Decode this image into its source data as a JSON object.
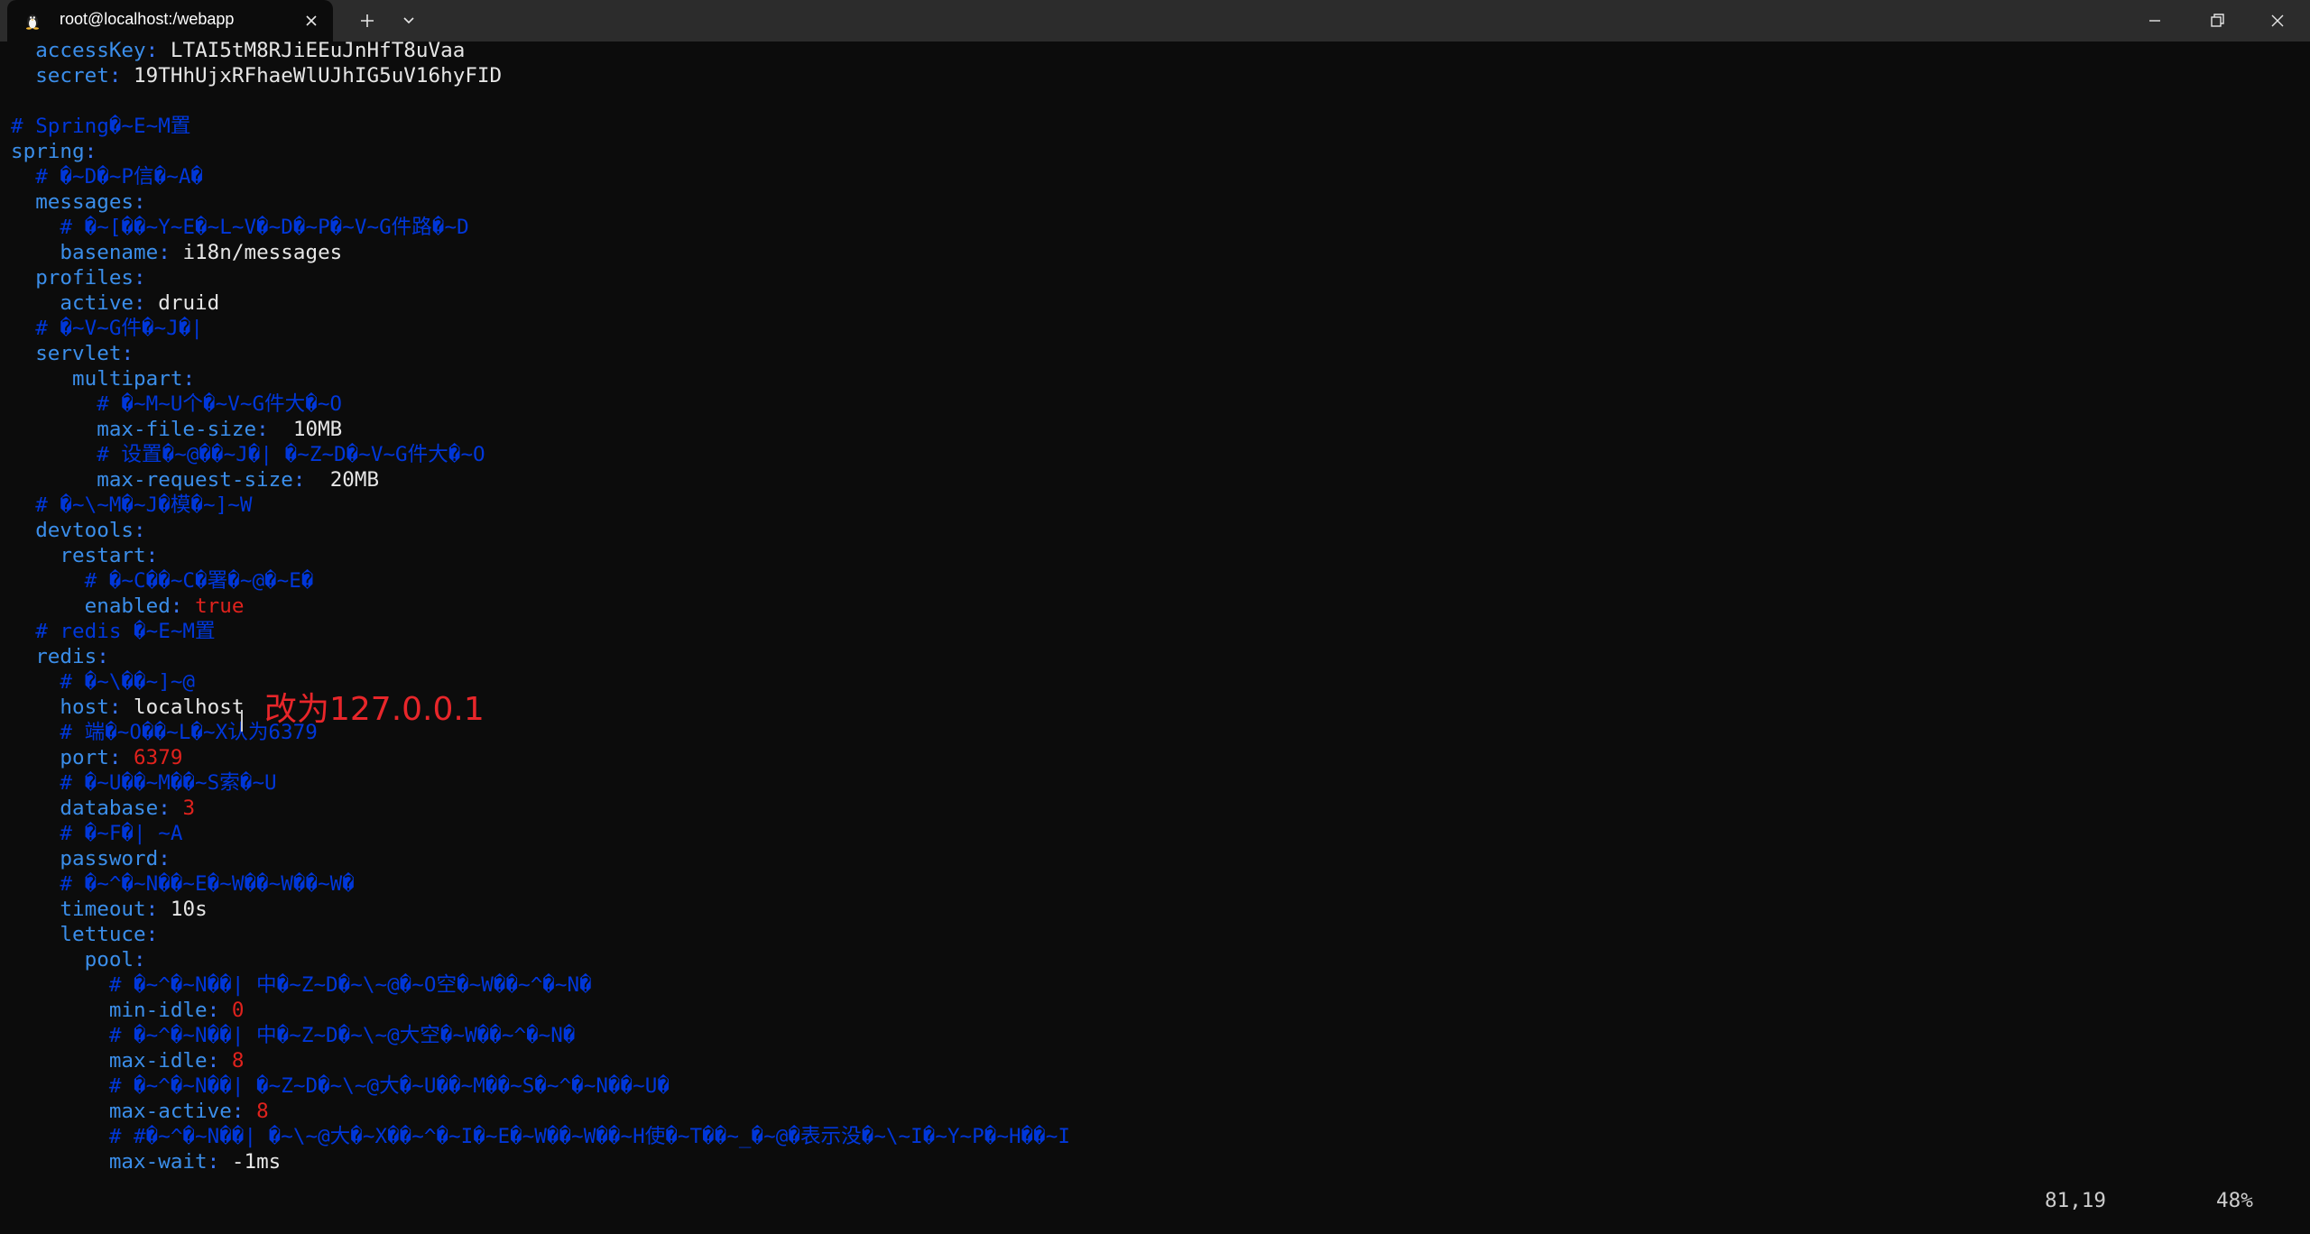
{
  "window": {
    "tab_title": "root@localhost:/webapp"
  },
  "annotation": {
    "text": "改为127.0.0.1",
    "color": "#e8262a"
  },
  "status_bar": {
    "position": "81,19",
    "percent": "48%"
  },
  "colors": {
    "background": "#0c0c0c",
    "key": "#3b8eea",
    "comment": "#0037da",
    "number": "#e0221d",
    "text": "#cccccc"
  },
  "editor": {
    "lines": [
      {
        "seg": [
          {
            "t": "  accessKey",
            "c": "k"
          },
          {
            "t": ": ",
            "c": "p"
          },
          {
            "t": "LTAI5tM8RJiEEuJnHfT8uVaa",
            "c": "v"
          }
        ]
      },
      {
        "seg": [
          {
            "t": "  secret",
            "c": "k"
          },
          {
            "t": ": ",
            "c": "p"
          },
          {
            "t": "19THhUjxRFhaeWlUJhIG5uV16hyFID",
            "c": "v"
          }
        ]
      },
      {
        "seg": []
      },
      {
        "seg": [
          {
            "t": "# Spring�~E~M置",
            "c": "c"
          }
        ]
      },
      {
        "seg": [
          {
            "t": "spring",
            "c": "k"
          },
          {
            "t": ":",
            "c": "p"
          }
        ]
      },
      {
        "seg": [
          {
            "t": "  # �~D�~P信�~A�",
            "c": "c"
          }
        ]
      },
      {
        "seg": [
          {
            "t": "  messages",
            "c": "k"
          },
          {
            "t": ":",
            "c": "p"
          }
        ]
      },
      {
        "seg": [
          {
            "t": "    # �~[��~Y~E�~L~V�~D�~P�~V~G件路�~D",
            "c": "c"
          }
        ]
      },
      {
        "seg": [
          {
            "t": "    basename",
            "c": "k"
          },
          {
            "t": ": ",
            "c": "p"
          },
          {
            "t": "i18n/messages",
            "c": "v"
          }
        ]
      },
      {
        "seg": [
          {
            "t": "  profiles",
            "c": "k"
          },
          {
            "t": ":",
            "c": "p"
          }
        ]
      },
      {
        "seg": [
          {
            "t": "    active",
            "c": "k"
          },
          {
            "t": ": ",
            "c": "p"
          },
          {
            "t": "druid",
            "c": "v"
          }
        ]
      },
      {
        "seg": [
          {
            "t": "  # �~V~G件�~J�|",
            "c": "c"
          }
        ]
      },
      {
        "seg": [
          {
            "t": "  servlet",
            "c": "k"
          },
          {
            "t": ":",
            "c": "p"
          }
        ]
      },
      {
        "seg": [
          {
            "t": "     multipart",
            "c": "k"
          },
          {
            "t": ":",
            "c": "p"
          }
        ]
      },
      {
        "seg": [
          {
            "t": "       # �~M~U个�~V~G件大�~O",
            "c": "c"
          }
        ]
      },
      {
        "seg": [
          {
            "t": "       max-file-size",
            "c": "k"
          },
          {
            "t": ":  ",
            "c": "p"
          },
          {
            "t": "10MB",
            "c": "v"
          }
        ]
      },
      {
        "seg": [
          {
            "t": "       # 设置�~@��~J�| �~Z~D�~V~G件大�~O",
            "c": "c"
          }
        ]
      },
      {
        "seg": [
          {
            "t": "       max-request-size",
            "c": "k"
          },
          {
            "t": ":  ",
            "c": "p"
          },
          {
            "t": "20MB",
            "c": "v"
          }
        ]
      },
      {
        "seg": [
          {
            "t": "  # �~\\~M�~J�模�~]~W",
            "c": "c"
          }
        ]
      },
      {
        "seg": [
          {
            "t": "  devtools",
            "c": "k"
          },
          {
            "t": ":",
            "c": "p"
          }
        ]
      },
      {
        "seg": [
          {
            "t": "    restart",
            "c": "k"
          },
          {
            "t": ":",
            "c": "p"
          }
        ]
      },
      {
        "seg": [
          {
            "t": "      # �~C��~C�署�~@�~E�",
            "c": "c"
          }
        ]
      },
      {
        "seg": [
          {
            "t": "      enabled",
            "c": "k"
          },
          {
            "t": ": ",
            "c": "p"
          },
          {
            "t": "true",
            "c": "n"
          }
        ]
      },
      {
        "seg": [
          {
            "t": "  # redis �~E~M置",
            "c": "c"
          }
        ]
      },
      {
        "seg": [
          {
            "t": "  redis",
            "c": "k"
          },
          {
            "t": ":",
            "c": "p"
          }
        ]
      },
      {
        "seg": [
          {
            "t": "    # �~\\��~]~@",
            "c": "c"
          }
        ]
      },
      {
        "seg": [
          {
            "t": "    host",
            "c": "k"
          },
          {
            "t": ": ",
            "c": "p"
          },
          {
            "t": "localhost",
            "c": "v"
          }
        ]
      },
      {
        "seg": [
          {
            "t": "    # 端�~O��~L�~X认为6379",
            "c": "c"
          }
        ]
      },
      {
        "seg": [
          {
            "t": "    port",
            "c": "k"
          },
          {
            "t": ": ",
            "c": "p"
          },
          {
            "t": "6379",
            "c": "n"
          }
        ]
      },
      {
        "seg": [
          {
            "t": "    # �~U��~M��~S索�~U",
            "c": "c"
          }
        ]
      },
      {
        "seg": [
          {
            "t": "    database",
            "c": "k"
          },
          {
            "t": ": ",
            "c": "p"
          },
          {
            "t": "3",
            "c": "n"
          }
        ]
      },
      {
        "seg": [
          {
            "t": "    # �~F�| ~A",
            "c": "c"
          }
        ]
      },
      {
        "seg": [
          {
            "t": "    password",
            "c": "k"
          },
          {
            "t": ":",
            "c": "p"
          }
        ]
      },
      {
        "seg": [
          {
            "t": "    # �~^�~N��~E�~W��~W��~W�",
            "c": "c"
          }
        ]
      },
      {
        "seg": [
          {
            "t": "    timeout",
            "c": "k"
          },
          {
            "t": ": ",
            "c": "p"
          },
          {
            "t": "10s",
            "c": "v"
          }
        ]
      },
      {
        "seg": [
          {
            "t": "    lettuce",
            "c": "k"
          },
          {
            "t": ":",
            "c": "p"
          }
        ]
      },
      {
        "seg": [
          {
            "t": "      pool",
            "c": "k"
          },
          {
            "t": ":",
            "c": "p"
          }
        ]
      },
      {
        "seg": [
          {
            "t": "        # �~^�~N��| 中�~Z~D�~\\~@�~O空�~W��~^�~N�",
            "c": "c"
          }
        ]
      },
      {
        "seg": [
          {
            "t": "        min-idle",
            "c": "k"
          },
          {
            "t": ": ",
            "c": "p"
          },
          {
            "t": "0",
            "c": "n"
          }
        ]
      },
      {
        "seg": [
          {
            "t": "        # �~^�~N��| 中�~Z~D�~\\~@大空�~W��~^�~N�",
            "c": "c"
          }
        ]
      },
      {
        "seg": [
          {
            "t": "        max-idle",
            "c": "k"
          },
          {
            "t": ": ",
            "c": "p"
          },
          {
            "t": "8",
            "c": "n"
          }
        ]
      },
      {
        "seg": [
          {
            "t": "        # �~^�~N��| �~Z~D�~\\~@大�~U��~M��~S�~^�~N��~U�",
            "c": "c"
          }
        ]
      },
      {
        "seg": [
          {
            "t": "        max-active",
            "c": "k"
          },
          {
            "t": ": ",
            "c": "p"
          },
          {
            "t": "8",
            "c": "n"
          }
        ]
      },
      {
        "seg": [
          {
            "t": "        # #�~^�~N��| �~\\~@大�~X��~^�~I�~E�~W��~W��~H使�~T��~_�~@�表示没�~\\~I�~Y~P�~H��~I",
            "c": "c"
          }
        ]
      },
      {
        "seg": [
          {
            "t": "        max-wait",
            "c": "k"
          },
          {
            "t": ": ",
            "c": "p"
          },
          {
            "t": "-1ms",
            "c": "v"
          }
        ]
      }
    ]
  }
}
